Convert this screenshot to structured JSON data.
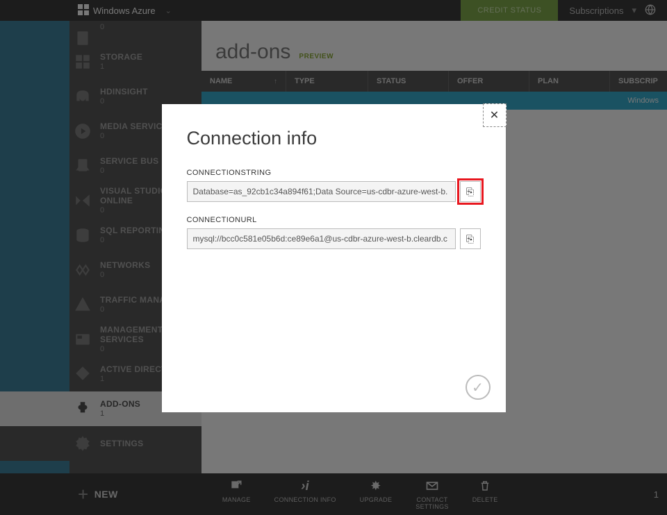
{
  "brand": "Windows Azure",
  "topbar": {
    "credit_status": "CREDIT STATUS",
    "subscriptions": "Subscriptions"
  },
  "sidebar": [
    {
      "key": "unknown-top",
      "label": "",
      "count": "0",
      "icon": "page"
    },
    {
      "key": "storage",
      "label": "STORAGE",
      "count": "1",
      "icon": "grid"
    },
    {
      "key": "hdinsight",
      "label": "HDINSIGHT",
      "count": "0",
      "icon": "elephant"
    },
    {
      "key": "media-services",
      "label": "MEDIA SERVICES",
      "count": "0",
      "icon": "play"
    },
    {
      "key": "service-bus",
      "label": "SERVICE BUS",
      "count": "0",
      "icon": "bus"
    },
    {
      "key": "visual-studio",
      "label": "VISUAL STUDIO ONLINE",
      "count": "0",
      "icon": "vs"
    },
    {
      "key": "sql-reporting",
      "label": "SQL REPORTING",
      "count": "0",
      "icon": "db"
    },
    {
      "key": "networks",
      "label": "NETWORKS",
      "count": "0",
      "icon": "net"
    },
    {
      "key": "traffic-mgr",
      "label": "TRAFFIC MANAGER",
      "count": "0",
      "icon": "traffic"
    },
    {
      "key": "mgmt-services",
      "label": "MANAGEMENT SERVICES",
      "count": "0",
      "icon": "mgmt"
    },
    {
      "key": "active-dir",
      "label": "ACTIVE DIRECTORY",
      "count": "1",
      "icon": "ad"
    },
    {
      "key": "add-ons",
      "label": "ADD-ONS",
      "count": "1",
      "icon": "addon",
      "active": true
    },
    {
      "key": "settings",
      "label": "SETTINGS",
      "count": "",
      "icon": "gear"
    }
  ],
  "page": {
    "title": "add-ons",
    "badge": "PREVIEW"
  },
  "table": {
    "headers": {
      "name": "NAME",
      "type": "TYPE",
      "status": "STATUS",
      "offer": "OFFER",
      "plan": "PLAN",
      "subscription": "SUBSCRIP"
    },
    "selected_row_right": "Windows"
  },
  "modal": {
    "title": "Connection info",
    "fields": [
      {
        "label": "CONNECTIONSTRING",
        "value": "Database=as_92cb1c34a894f61;Data Source=us-cdbr-azure-west-b.",
        "highlight_copy": true
      },
      {
        "label": "CONNECTIONURL",
        "value": "mysql://bcc0c581e05b6d:ce89e6a1@us-cdbr-azure-west-b.cleardb.c",
        "highlight_copy": false
      }
    ]
  },
  "cmdbar": {
    "new": "NEW",
    "actions": [
      {
        "key": "manage",
        "label": "MANAGE"
      },
      {
        "key": "connection-info",
        "label": "CONNECTION INFO"
      },
      {
        "key": "upgrade",
        "label": "UPGRADE"
      },
      {
        "key": "contact",
        "label": "CONTACT\nSETTINGS"
      },
      {
        "key": "delete",
        "label": "DELETE"
      }
    ],
    "right_count": "1"
  }
}
